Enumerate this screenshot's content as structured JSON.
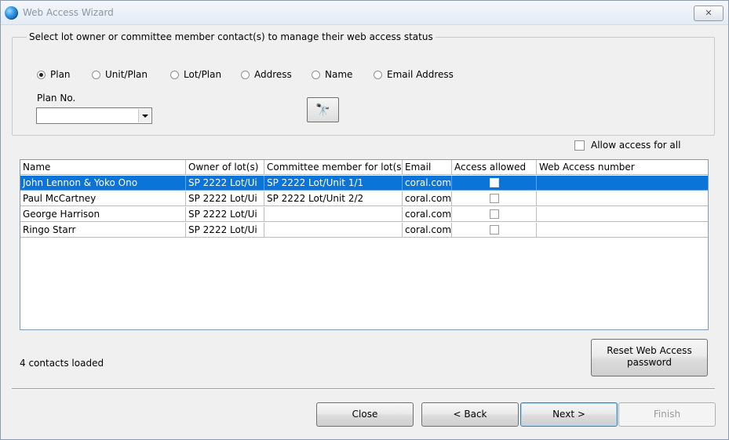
{
  "window": {
    "title": "Web Access Wizard",
    "close_glyph": "✕",
    "app_icon": "globe-icon"
  },
  "search": {
    "group_label": "Select lot owner or committee member contact(s) to manage their web access status",
    "radios": [
      {
        "label": "Plan",
        "checked": true
      },
      {
        "label": "Unit/Plan",
        "checked": false
      },
      {
        "label": "Lot/Plan",
        "checked": false
      },
      {
        "label": "Address",
        "checked": false
      },
      {
        "label": "Name",
        "checked": false
      },
      {
        "label": "Email Address",
        "checked": false
      }
    ],
    "plan_label": "Plan No.",
    "plan_value": "",
    "find_icon": "binoculars-icon",
    "find_glyph": "🔭"
  },
  "allow_all": {
    "label": "Allow access for all",
    "checked": false
  },
  "table": {
    "columns": [
      "Name",
      "Owner of lot(s)",
      "Committee member for lot(s)",
      "Email",
      "Access allowed",
      "Web Access number"
    ],
    "rows": [
      {
        "name": "John Lennon & Yoko Ono",
        "owner": "SP 2222 Lot/Ui",
        "committee": "SP 2222 Lot/Unit 1/1",
        "email": "coral.com",
        "access": false,
        "number": ""
      },
      {
        "name": "Paul McCartney",
        "owner": "SP 2222 Lot/Ui",
        "committee": "SP 2222 Lot/Unit 2/2",
        "email": "coral.com",
        "access": false,
        "number": ""
      },
      {
        "name": "George Harrison",
        "owner": "SP 2222 Lot/Ui",
        "committee": "",
        "email": "coral.com",
        "access": false,
        "number": ""
      },
      {
        "name": "Ringo Starr",
        "owner": "SP 2222 Lot/Ui",
        "committee": "",
        "email": "coral.com",
        "access": false,
        "number": ""
      }
    ],
    "selected_row": 0
  },
  "status": "4 contacts loaded",
  "buttons": {
    "reset_line1": "Reset Web Access",
    "reset_line2": "password",
    "close": "Close",
    "back": "< Back",
    "next": "Next >",
    "finish": "Finish"
  }
}
